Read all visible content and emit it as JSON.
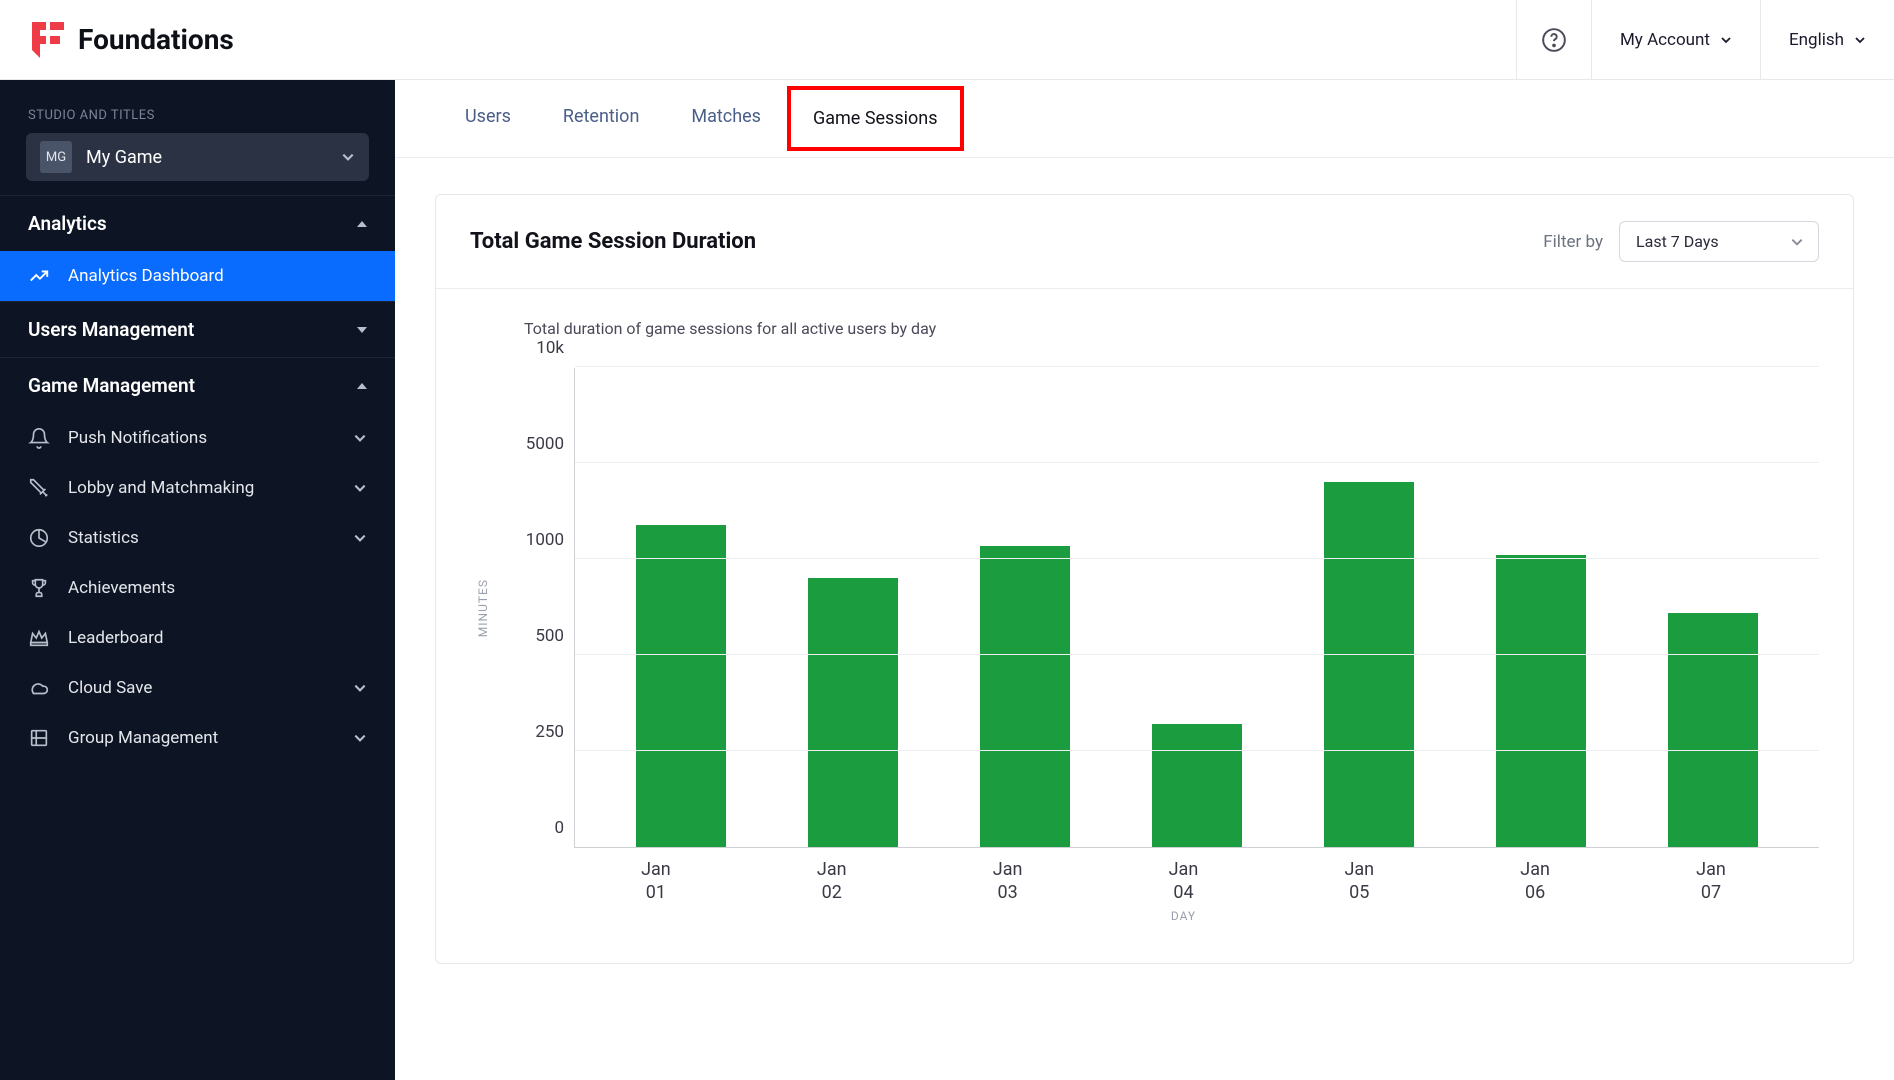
{
  "header": {
    "brand": "Foundations",
    "my_account": "My Account",
    "language": "English"
  },
  "sidebar": {
    "section_label": "STUDIO AND TITLES",
    "game_badge": "MG",
    "game_name": "My Game",
    "analytics_head": "Analytics",
    "analytics_dashboard": "Analytics Dashboard",
    "users_mgmt_head": "Users Management",
    "game_mgmt_head": "Game Management",
    "items": {
      "push": "Push Notifications",
      "lobby": "Lobby and Matchmaking",
      "stats": "Statistics",
      "achieve": "Achievements",
      "leader": "Leaderboard",
      "cloud": "Cloud Save",
      "group": "Group Management"
    }
  },
  "tabs": {
    "users": "Users",
    "retention": "Retention",
    "matches": "Matches",
    "sessions": "Game Sessions"
  },
  "card": {
    "title": "Total Game Session Duration",
    "filter_label": "Filter by",
    "filter_value": "Last 7 Days",
    "subtitle": "Total duration of game sessions for all active users by day"
  },
  "chart_data": {
    "type": "bar",
    "title": "Total Game Session Duration",
    "subtitle": "Total duration of game sessions for all active users by day",
    "xlabel": "DAY",
    "ylabel": "MINUTES",
    "ylim": [
      0,
      10000
    ],
    "yticks": [
      0,
      250,
      500,
      1000,
      5000,
      "10k"
    ],
    "ytick_values": [
      0,
      250,
      500,
      1000,
      5000,
      10000
    ],
    "categories": [
      "Jan\n01",
      "Jan\n02",
      "Jan\n03",
      "Jan\n04",
      "Jan\n05",
      "Jan\n06",
      "Jan\n07"
    ],
    "values": [
      2400,
      900,
      1550,
      320,
      4200,
      1150,
      720
    ],
    "bar_color": "#1a9c3f"
  }
}
